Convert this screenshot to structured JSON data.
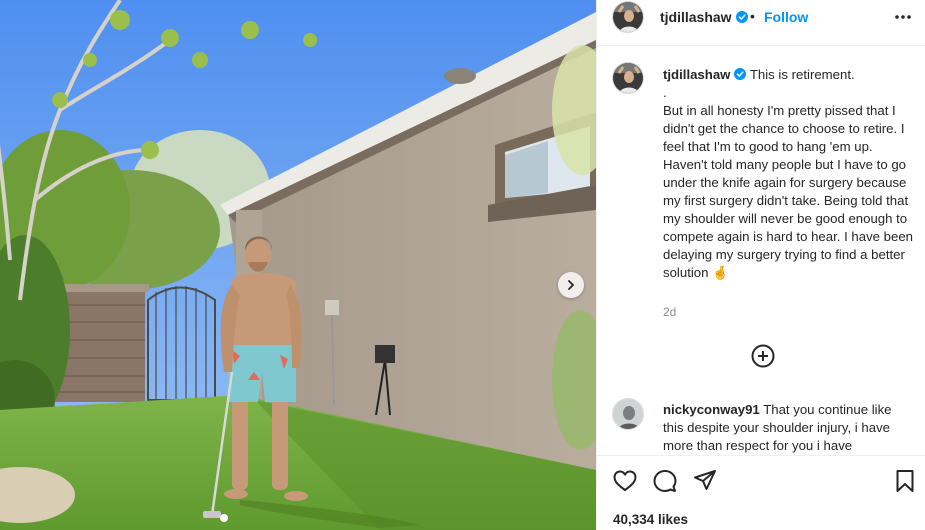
{
  "post": {
    "photo_alt": "Shirtless man holding a putter on a backyard putting green",
    "photo_has_next": true
  },
  "header": {
    "username": "tjdillashaw",
    "verified": true,
    "separator": "•",
    "follow_label": "Follow"
  },
  "caption": {
    "username": "tjdillashaw",
    "text": "This is retirement.\n.\nBut in all honesty I'm pretty pissed that I didn't get the chance to choose to retire. I feel that I'm to good to hang 'em up. Haven't told many people but I have to go under the knife again for surgery because my first surgery didn't take. Being told that my shoulder will never be good enough to compete again is hard to hear. I have been delaying my surgery trying to find a better solution 🤞",
    "age": "2d"
  },
  "comments": [
    {
      "username": "nickyconway91",
      "text": "That you continue like this despite your shoulder injury, i have more than respect for you i have"
    }
  ],
  "icons": {
    "more": "more-horizontal-icon",
    "next": "chevron-right-icon",
    "load_more": "plus-circle-icon",
    "like": "heart-icon",
    "comment": "comment-icon",
    "share": "send-icon",
    "save": "bookmark-icon",
    "verified": "verified-badge-icon"
  },
  "colors": {
    "accent": "#0095f6",
    "verified": "#0095f6",
    "secondary_text": "#8e8e8e",
    "sky": "#6fa6f2",
    "lawn": "#6ea43a"
  },
  "stats": {
    "likes_label": "40,334 likes"
  }
}
